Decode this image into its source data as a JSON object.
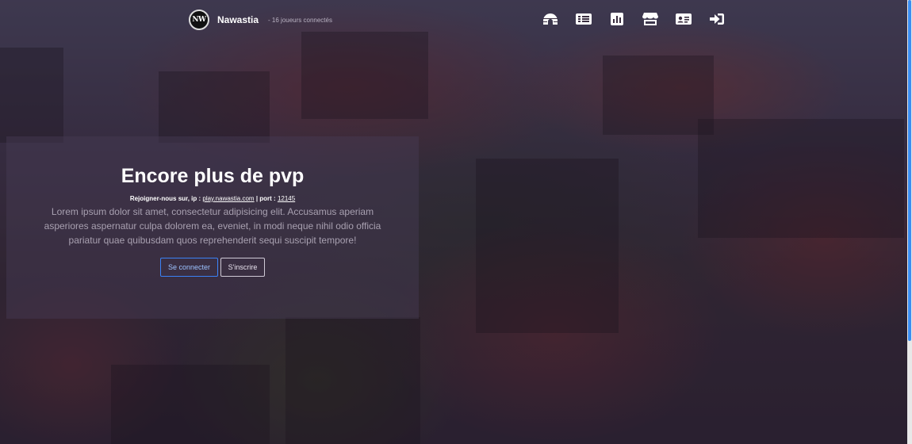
{
  "brand": {
    "logo_text": "NW",
    "name": "Nawastia",
    "status": "- 16 joueurs connectés"
  },
  "nav": {
    "items": [
      {
        "icon": "igloo-icon"
      },
      {
        "icon": "list-icon"
      },
      {
        "icon": "chart-icon"
      },
      {
        "icon": "store-icon"
      },
      {
        "icon": "id-card-icon"
      },
      {
        "icon": "sign-in-icon"
      }
    ]
  },
  "hero": {
    "title": "Encore plus de pvp",
    "ip_prefix": "Rejoigner-nous sur, ip : ",
    "ip_value": "play.nawastia.com",
    "port_prefix": " | port : ",
    "port_value": "12145",
    "description": "Lorem ipsum dolor sit amet, consectetur adipisicing elit. Accusamus aperiam asperiores aspernatur culpa dolorem ea, eveniet, in modi neque nihil odio officia pariatur quae quibusdam quos reprehenderit sequi suscipit tempore!",
    "login_label": "Se connecter",
    "register_label": "S'inscrire"
  },
  "colors": {
    "accent": "#3b82f6",
    "scrollbar_thumb": "#3a8ef2"
  }
}
